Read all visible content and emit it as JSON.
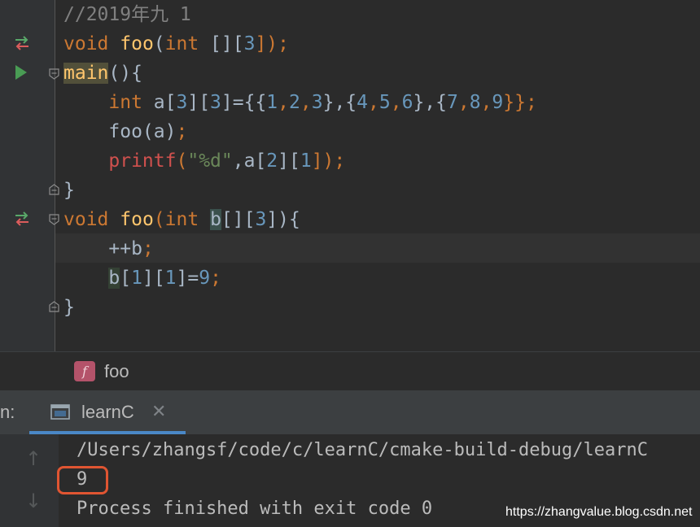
{
  "editor": {
    "lines": {
      "l1": {
        "comment": "//2019年九 1"
      },
      "l2": {
        "kw_void": "void",
        "fn_foo": "foo",
        "p_open": "(",
        "kw_int": "int",
        "sp_br": " [][",
        "n3": "3",
        "end": "]);"
      },
      "l3": {
        "fn_main": "main",
        "rest": "(){"
      },
      "l4": {
        "kw_int": "int",
        "a": " a[",
        "n3a": "3",
        "m1": "][",
        "n3b": "3",
        "m2": "]={{",
        "n1": "1",
        "c1": ",",
        "n2": "2",
        "c2": ",",
        "n3": "3",
        "m3": "},{",
        "n4": "4",
        "c3": ",",
        "n5": "5",
        "c4": ",",
        "n6": "6",
        "m4": "},{",
        "n7": "7",
        "c5": ",",
        "n8": "8",
        "c6": ",",
        "n9": "9",
        "end": "}};"
      },
      "l5": {
        "call": "foo(a)",
        "semi": ";"
      },
      "l6": {
        "printf": "printf",
        "p_open": "(",
        "str": "\"%d\"",
        "a": ",a[",
        "n2": "2",
        "m": "][",
        "n1": "1",
        "end": "]);"
      },
      "l7": {
        "brace": "}"
      },
      "l8": {
        "kw_void": "void",
        "fn_foo": "foo",
        "p_open": "(",
        "kw_int": "int",
        "b": "b",
        "br": "[][",
        "n3": "3",
        "end": "]){"
      },
      "l9": {
        "pp": "++b",
        "semi": ";"
      },
      "l10": {
        "b": "b",
        "br1": "[",
        "n1a": "1",
        "br2": "][",
        "n1b": "1",
        "br3": "]=",
        "n9": "9",
        "semi": ";"
      },
      "l11": {
        "brace": "}"
      }
    },
    "colors": {
      "background": "#2b2b2b",
      "keyword": "#cc7832",
      "function": "#ffc66d",
      "number": "#6897bb",
      "string": "#6a8759",
      "comment": "#808080",
      "macro": "#d1514e"
    }
  },
  "gutter_icons": [
    "implementation-arrows-icon",
    "run-icon",
    "implementation-arrows-icon"
  ],
  "breadcrumb": {
    "badge": "f",
    "label": "foo"
  },
  "run_panel": {
    "label": "n:",
    "tab_label": "learnC",
    "close_glyph": "✕",
    "up_arrow": "↑",
    "down_arrow": "↓",
    "accent": "#4a88c7"
  },
  "console": {
    "path": "/Users/zhangsf/code/c/learnC/cmake-build-debug/learnC",
    "output": "9",
    "finish": "Process finished with exit code 0",
    "highlight_color": "#e05532"
  },
  "watermark": "https://zhangvalue.blog.csdn.net"
}
